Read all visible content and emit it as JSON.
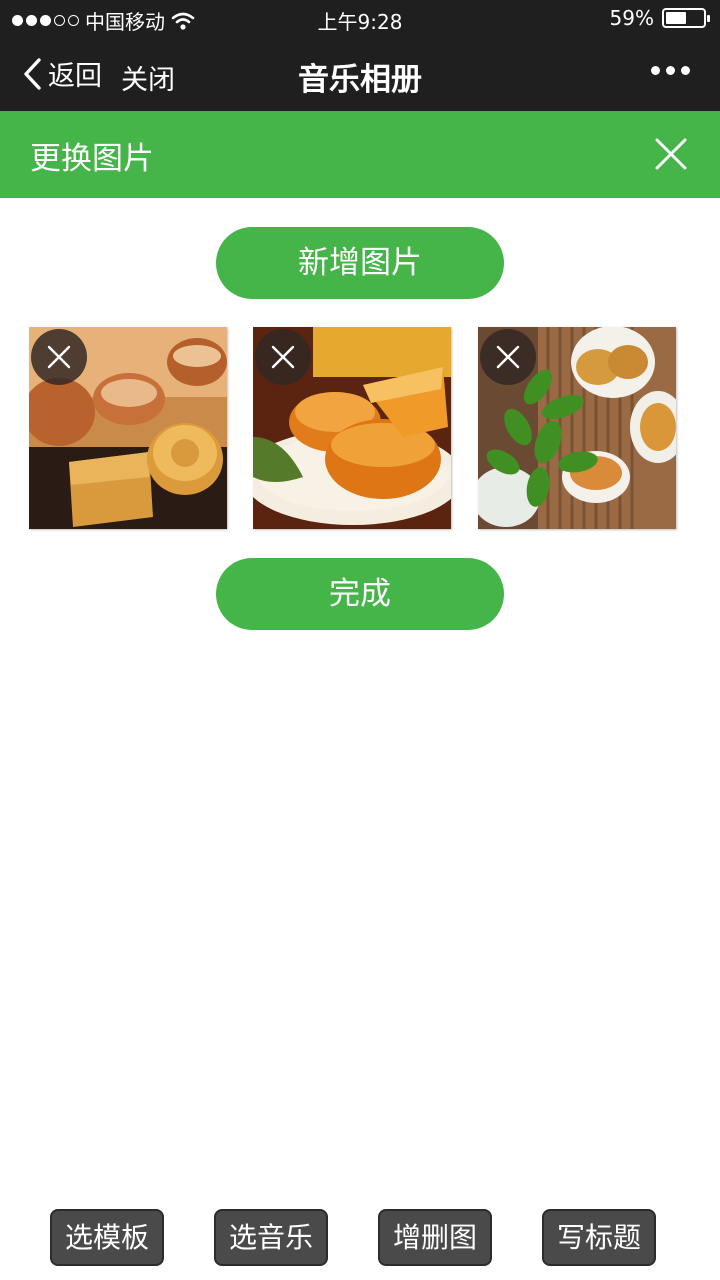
{
  "status_bar": {
    "carrier": "中国移动",
    "time": "上午9:28",
    "battery_percent": "59%",
    "battery_level": 0.59,
    "signal_filled": 3,
    "signal_total": 5,
    "icons": [
      "signal-dots-icon",
      "wifi-icon",
      "battery-icon"
    ]
  },
  "nav": {
    "back_label": "返回",
    "close_label": "关闭",
    "title": "音乐相册",
    "icons": [
      "chevron-left-icon",
      "more-dots-icon"
    ]
  },
  "panel": {
    "title": "更换图片",
    "close_icon": "close-icon",
    "add_button": "新增图片",
    "done_button": "完成"
  },
  "images": [
    {
      "subject": "mooncakes with tea set",
      "remove_icon": "remove-icon"
    },
    {
      "subject": "mooncakes on plate",
      "remove_icon": "remove-icon"
    },
    {
      "subject": "mooncakes with tea and green leaves",
      "remove_icon": "remove-icon"
    }
  ],
  "toolbar": {
    "items": [
      "选模板",
      "选音乐",
      "增删图",
      "写标题"
    ]
  },
  "colors": {
    "accent_green": "#46b549",
    "dark_bar": "#1f1f1f",
    "toolbar_button": "#4a4a4a"
  }
}
